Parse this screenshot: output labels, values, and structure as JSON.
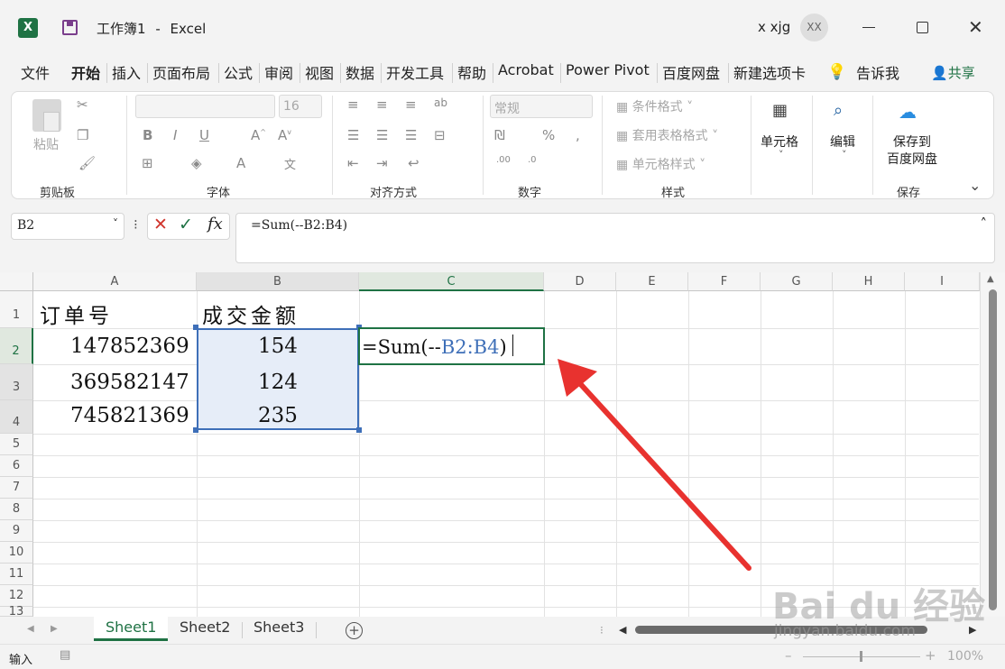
{
  "titlebar": {
    "workbook": "工作簿1",
    "sep": "-",
    "app": "Excel",
    "user": "x xjg",
    "avatar": "XX"
  },
  "menu": {
    "file": "文件",
    "home": "开始",
    "insert": "插入",
    "layout": "页面布局",
    "formula": "公式",
    "review": "审阅",
    "view": "视图",
    "data": "数据",
    "developer": "开发工具",
    "help": "帮助",
    "acrobat": "Acrobat",
    "powerpivot": "Power Pivot",
    "baidu": "百度网盘",
    "newtab": "新建选项卡",
    "tellme": "告诉我",
    "share": "共享"
  },
  "ribbon": {
    "paste": "粘贴",
    "clipboard": "剪贴板",
    "font_size": "16",
    "font_group": "字体",
    "align_group": "对齐方式",
    "number_format": "常规",
    "number_group": "数字",
    "cond_format": "条件格式",
    "table_format": "套用表格格式",
    "cell_style": "单元格样式",
    "style_group": "样式",
    "cells": "单元格",
    "edit": "编辑",
    "save_to_line1": "保存到",
    "save_to_line2": "百度网盘",
    "save_group": "保存"
  },
  "formula_bar": {
    "name_box": "B2",
    "fx": "fx",
    "formula": "=Sum(--B2:B4)"
  },
  "sheet": {
    "columns": [
      "A",
      "B",
      "C",
      "D",
      "E",
      "F",
      "G",
      "H",
      "I"
    ],
    "rows": [
      "1",
      "2",
      "3",
      "4",
      "5",
      "6",
      "7",
      "8",
      "9",
      "10",
      "11",
      "12",
      "13"
    ],
    "a1": "订单号",
    "b1": "成交金额",
    "a2": "147852369",
    "b2": "154",
    "a3": "369582147",
    "b3": "124",
    "a4": "745821369",
    "b4": "235",
    "c2_prefix": "=Sum(--",
    "c2_ref": "B2:B4",
    "c2_suffix": ")"
  },
  "tabs": [
    "Sheet1",
    "Sheet2",
    "Sheet3"
  ],
  "status": {
    "mode": "输入",
    "zoom": "100%",
    "minus": "–",
    "plus": "+"
  },
  "watermark": {
    "brand": "Bai du 经验",
    "url": "jingyan.baidu.com"
  },
  "colors": {
    "excel_green": "#1f7244",
    "ref_blue": "#3e6fb8",
    "selection_fill": "#e6edf8",
    "arrow_red": "#e8322f"
  }
}
